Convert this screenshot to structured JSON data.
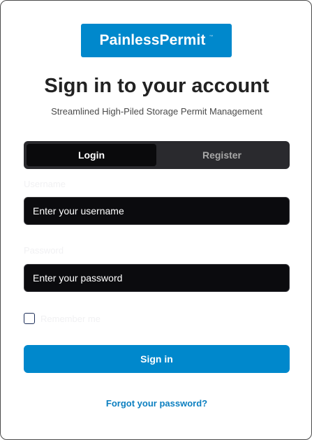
{
  "brand": {
    "name": "PainlessPermit",
    "trademark": "™",
    "color": "#0088cc"
  },
  "title": "Sign in to your account",
  "subtitle": "Streamlined High-Piled Storage Permit Management",
  "tabs": {
    "login": "Login",
    "register": "Register",
    "active": "Login"
  },
  "form": {
    "username_label": "Username",
    "username_placeholder": "Enter your username",
    "password_label": "Password",
    "password_placeholder": "Enter your password",
    "remember_label": "Remember me",
    "remember_checked": false,
    "submit_label": "Sign in"
  },
  "forgot_password": "Forgot your password?"
}
